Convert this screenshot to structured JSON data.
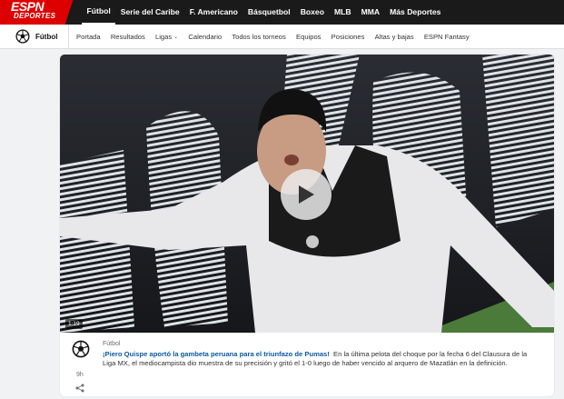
{
  "brand": {
    "logo_line1": "ESPN",
    "logo_line2": "DEPORTES",
    "logo_color": "#dd0000"
  },
  "top_nav": {
    "items": [
      {
        "label": "Fútbol",
        "active": true
      },
      {
        "label": "Serie del Caribe"
      },
      {
        "label": "F. Americano"
      },
      {
        "label": "Básquetbol"
      },
      {
        "label": "Boxeo"
      },
      {
        "label": "MLB"
      },
      {
        "label": "MMA"
      },
      {
        "label": "Más Deportes"
      }
    ]
  },
  "section_nav": {
    "section_label": "Fútbol",
    "section_icon": "soccer-ball-icon",
    "items": [
      {
        "label": "Portada"
      },
      {
        "label": "Resultados"
      },
      {
        "label": "Ligas",
        "dropdown": true
      },
      {
        "label": "Calendario"
      },
      {
        "label": "Todos los torneos"
      },
      {
        "label": "Equipos"
      },
      {
        "label": "Posiciones"
      },
      {
        "label": "Altas y bajas"
      },
      {
        "label": "ESPN Fantasy"
      }
    ]
  },
  "video": {
    "duration": "1:19",
    "play_icon": "play-icon"
  },
  "story": {
    "category": "Fútbol",
    "category_icon": "soccer-ball-icon",
    "age": "9h",
    "share_icon": "share-icon",
    "headline": "¡Piero Quispe aportó la gambeta peruana para el triunfazo de Pumas!",
    "summary": "En la última pelota del choque por la fecha 6 del Clausura de la Liga MX, el mediocampista dio muestra de su precisión y gritó el 1-0 luego de haber vencido al arquero de Mazatlán en la definición.",
    "headline_color": "#0a5aa3"
  }
}
